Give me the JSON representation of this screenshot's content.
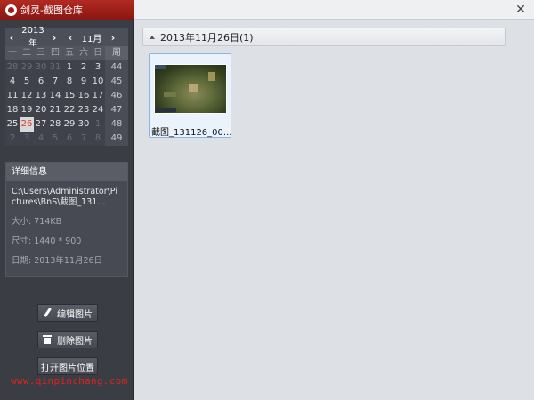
{
  "window": {
    "title": "剑灵-截图仓库",
    "close_glyph": "✕"
  },
  "calendar": {
    "year": "2013年",
    "month": "11月",
    "weekdays": [
      "一",
      "二",
      "三",
      "四",
      "五",
      "六",
      "日"
    ],
    "week_col": "周",
    "weeks": [
      {
        "num": "44",
        "days": [
          {
            "d": "28",
            "dim": true
          },
          {
            "d": "29",
            "dim": true
          },
          {
            "d": "30",
            "dim": true
          },
          {
            "d": "31",
            "dim": true
          },
          {
            "d": "1"
          },
          {
            "d": "2"
          },
          {
            "d": "3"
          }
        ]
      },
      {
        "num": "45",
        "days": [
          {
            "d": "4"
          },
          {
            "d": "5"
          },
          {
            "d": "6"
          },
          {
            "d": "7"
          },
          {
            "d": "8"
          },
          {
            "d": "9"
          },
          {
            "d": "10"
          }
        ]
      },
      {
        "num": "46",
        "days": [
          {
            "d": "11"
          },
          {
            "d": "12"
          },
          {
            "d": "13"
          },
          {
            "d": "14"
          },
          {
            "d": "15"
          },
          {
            "d": "16"
          },
          {
            "d": "17"
          }
        ]
      },
      {
        "num": "47",
        "days": [
          {
            "d": "18"
          },
          {
            "d": "19"
          },
          {
            "d": "20"
          },
          {
            "d": "21"
          },
          {
            "d": "22"
          },
          {
            "d": "23"
          },
          {
            "d": "24"
          }
        ]
      },
      {
        "num": "48",
        "days": [
          {
            "d": "25"
          },
          {
            "d": "26",
            "sel": true
          },
          {
            "d": "27"
          },
          {
            "d": "28"
          },
          {
            "d": "29"
          },
          {
            "d": "30"
          },
          {
            "d": "1",
            "dim": true
          }
        ]
      },
      {
        "num": "49",
        "days": [
          {
            "d": "2",
            "dim": true
          },
          {
            "d": "3",
            "dim": true
          },
          {
            "d": "4",
            "dim": true
          },
          {
            "d": "5",
            "dim": true
          },
          {
            "d": "6",
            "dim": true
          },
          {
            "d": "7",
            "dim": true
          },
          {
            "d": "8",
            "dim": true
          }
        ]
      }
    ]
  },
  "detail": {
    "header": "详细信息",
    "path": "C:\\Users\\Administrator\\Pictures\\BnS\\截图_131...",
    "size": "大小:  714KB",
    "dimensions": "尺寸:  1440 * 900",
    "date": "日期:  2013年11月26日"
  },
  "actions": {
    "edit": "编辑图片",
    "delete": "删除图片",
    "open_location": "打开图片位置"
  },
  "watermark": "www.qinpinchang.com",
  "gallery": {
    "group_title": "2013年11月26日(1)",
    "items": [
      {
        "caption": "截图_131126_00..."
      }
    ]
  },
  "colors": {
    "title_red": "#a21c16",
    "sidebar_bg": "#3b3d44",
    "selected_day": "#d63a2a",
    "thumb_border": "#8ab6e0",
    "watermark": "#e0231b"
  }
}
